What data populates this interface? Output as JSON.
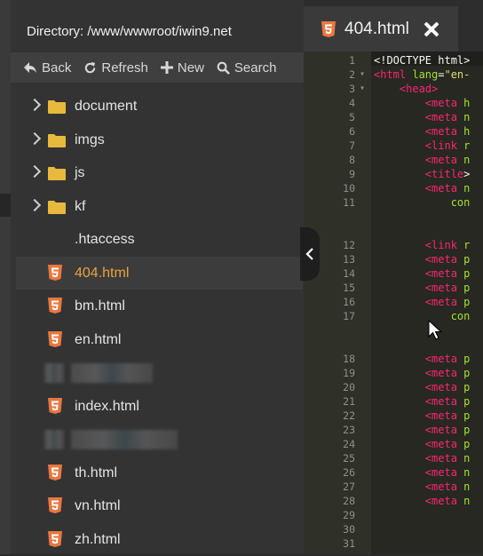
{
  "sidebar": {
    "directory_label": "Directory: /www/wwwroot/iwin9.net",
    "toolbar": {
      "back": "Back",
      "refresh": "Refresh",
      "new": "New",
      "search": "Search"
    },
    "items": [
      {
        "name": "document",
        "type": "folder"
      },
      {
        "name": "imgs",
        "type": "folder"
      },
      {
        "name": "js",
        "type": "folder"
      },
      {
        "name": "kf",
        "type": "folder"
      },
      {
        "name": ".htaccess",
        "type": "file"
      },
      {
        "name": "404.html",
        "type": "html",
        "active": true
      },
      {
        "name": "bm.html",
        "type": "html"
      },
      {
        "name": "en.html",
        "type": "html"
      },
      {
        "name": "",
        "type": "redacted"
      },
      {
        "name": "index.html",
        "type": "html"
      },
      {
        "name": "",
        "type": "redacted"
      },
      {
        "name": "th.html",
        "type": "html"
      },
      {
        "name": "vn.html",
        "type": "html"
      },
      {
        "name": "zh.html",
        "type": "html"
      }
    ]
  },
  "editor": {
    "tab_title": "404.html",
    "code_lines": [
      {
        "num": "1",
        "fold": "",
        "segments": [
          [
            "white",
            "<!DOCTYPE html>"
          ]
        ]
      },
      {
        "num": "2",
        "fold": "▾",
        "segments": [
          [
            "pink",
            "<html"
          ],
          [
            "green",
            " lang"
          ],
          [
            "white",
            "="
          ],
          [
            "yellow",
            "\"en-"
          ]
        ]
      },
      {
        "num": "3",
        "fold": "▾",
        "segments": [
          [
            "white",
            "    "
          ],
          [
            "pink",
            "<head>"
          ]
        ]
      },
      {
        "num": "4",
        "fold": "",
        "segments": [
          [
            "white",
            "        "
          ],
          [
            "pink",
            "<meta"
          ],
          [
            "green",
            " h"
          ]
        ]
      },
      {
        "num": "5",
        "fold": "",
        "segments": [
          [
            "white",
            "        "
          ],
          [
            "pink",
            "<meta"
          ],
          [
            "green",
            " n"
          ]
        ]
      },
      {
        "num": "6",
        "fold": "",
        "segments": [
          [
            "white",
            "        "
          ],
          [
            "pink",
            "<meta"
          ],
          [
            "green",
            " h"
          ]
        ]
      },
      {
        "num": "7",
        "fold": "",
        "segments": [
          [
            "white",
            "        "
          ],
          [
            "pink",
            "<link"
          ],
          [
            "green",
            " r"
          ]
        ]
      },
      {
        "num": "8",
        "fold": "",
        "segments": [
          [
            "white",
            "        "
          ],
          [
            "pink",
            "<meta"
          ],
          [
            "green",
            " n"
          ]
        ]
      },
      {
        "num": "9",
        "fold": "",
        "segments": [
          [
            "white",
            "        "
          ],
          [
            "pink",
            "<title"
          ],
          [
            "white",
            ">"
          ]
        ]
      },
      {
        "num": "10",
        "fold": "",
        "segments": [
          [
            "white",
            "        "
          ],
          [
            "pink",
            "<meta"
          ],
          [
            "green",
            " n"
          ]
        ]
      },
      {
        "num": "11",
        "fold": "",
        "segments": [
          [
            "white",
            "            "
          ],
          [
            "green",
            "con"
          ]
        ]
      },
      {
        "num": "12",
        "fold": "",
        "segments": [
          [
            "white",
            "        "
          ],
          [
            "pink",
            "<link"
          ],
          [
            "green",
            " r"
          ]
        ]
      },
      {
        "num": "13",
        "fold": "",
        "segments": [
          [
            "white",
            "        "
          ],
          [
            "pink",
            "<meta"
          ],
          [
            "green",
            " p"
          ]
        ]
      },
      {
        "num": "14",
        "fold": "",
        "segments": [
          [
            "white",
            "        "
          ],
          [
            "pink",
            "<meta"
          ],
          [
            "green",
            " p"
          ]
        ]
      },
      {
        "num": "15",
        "fold": "",
        "segments": [
          [
            "white",
            "        "
          ],
          [
            "pink",
            "<meta"
          ],
          [
            "green",
            " p"
          ]
        ]
      },
      {
        "num": "16",
        "fold": "",
        "segments": [
          [
            "white",
            "        "
          ],
          [
            "pink",
            "<meta"
          ],
          [
            "green",
            " p"
          ]
        ]
      },
      {
        "num": "17",
        "fold": "",
        "segments": [
          [
            "white",
            "            "
          ],
          [
            "green",
            "con"
          ]
        ]
      },
      {
        "num": "18",
        "fold": "",
        "segments": [
          [
            "white",
            "        "
          ],
          [
            "pink",
            "<meta"
          ],
          [
            "green",
            " p"
          ]
        ]
      },
      {
        "num": "19",
        "fold": "",
        "segments": [
          [
            "white",
            "        "
          ],
          [
            "pink",
            "<meta"
          ],
          [
            "green",
            " p"
          ]
        ]
      },
      {
        "num": "20",
        "fold": "",
        "segments": [
          [
            "white",
            "        "
          ],
          [
            "pink",
            "<meta"
          ],
          [
            "green",
            " p"
          ]
        ]
      },
      {
        "num": "21",
        "fold": "",
        "segments": [
          [
            "white",
            "        "
          ],
          [
            "pink",
            "<meta"
          ],
          [
            "green",
            " p"
          ]
        ]
      },
      {
        "num": "22",
        "fold": "",
        "segments": [
          [
            "white",
            "        "
          ],
          [
            "pink",
            "<meta"
          ],
          [
            "green",
            " p"
          ]
        ]
      },
      {
        "num": "23",
        "fold": "",
        "segments": [
          [
            "white",
            "        "
          ],
          [
            "pink",
            "<meta"
          ],
          [
            "green",
            " p"
          ]
        ]
      },
      {
        "num": "24",
        "fold": "",
        "segments": [
          [
            "white",
            "        "
          ],
          [
            "pink",
            "<meta"
          ],
          [
            "green",
            " p"
          ]
        ]
      },
      {
        "num": "25",
        "fold": "",
        "segments": [
          [
            "white",
            "        "
          ],
          [
            "pink",
            "<meta"
          ],
          [
            "green",
            " n"
          ]
        ]
      },
      {
        "num": "26",
        "fold": "",
        "segments": [
          [
            "white",
            "        "
          ],
          [
            "pink",
            "<meta"
          ],
          [
            "green",
            " n"
          ]
        ]
      },
      {
        "num": "27",
        "fold": "",
        "segments": [
          [
            "white",
            "        "
          ],
          [
            "pink",
            "<meta"
          ],
          [
            "green",
            " n"
          ]
        ]
      },
      {
        "num": "28",
        "fold": "",
        "segments": [
          [
            "white",
            "        "
          ],
          [
            "pink",
            "<meta"
          ],
          [
            "green",
            " n"
          ]
        ]
      },
      {
        "num": "29",
        "fold": "",
        "segments": []
      },
      {
        "num": "30",
        "fold": "",
        "segments": []
      },
      {
        "num": "31",
        "fold": "",
        "segments": []
      }
    ]
  },
  "colors": {
    "accent_tab": "#35b54a",
    "active_file": "#e8a33d",
    "folder": "#e8b93c",
    "html5_icon": "#e9773f"
  }
}
